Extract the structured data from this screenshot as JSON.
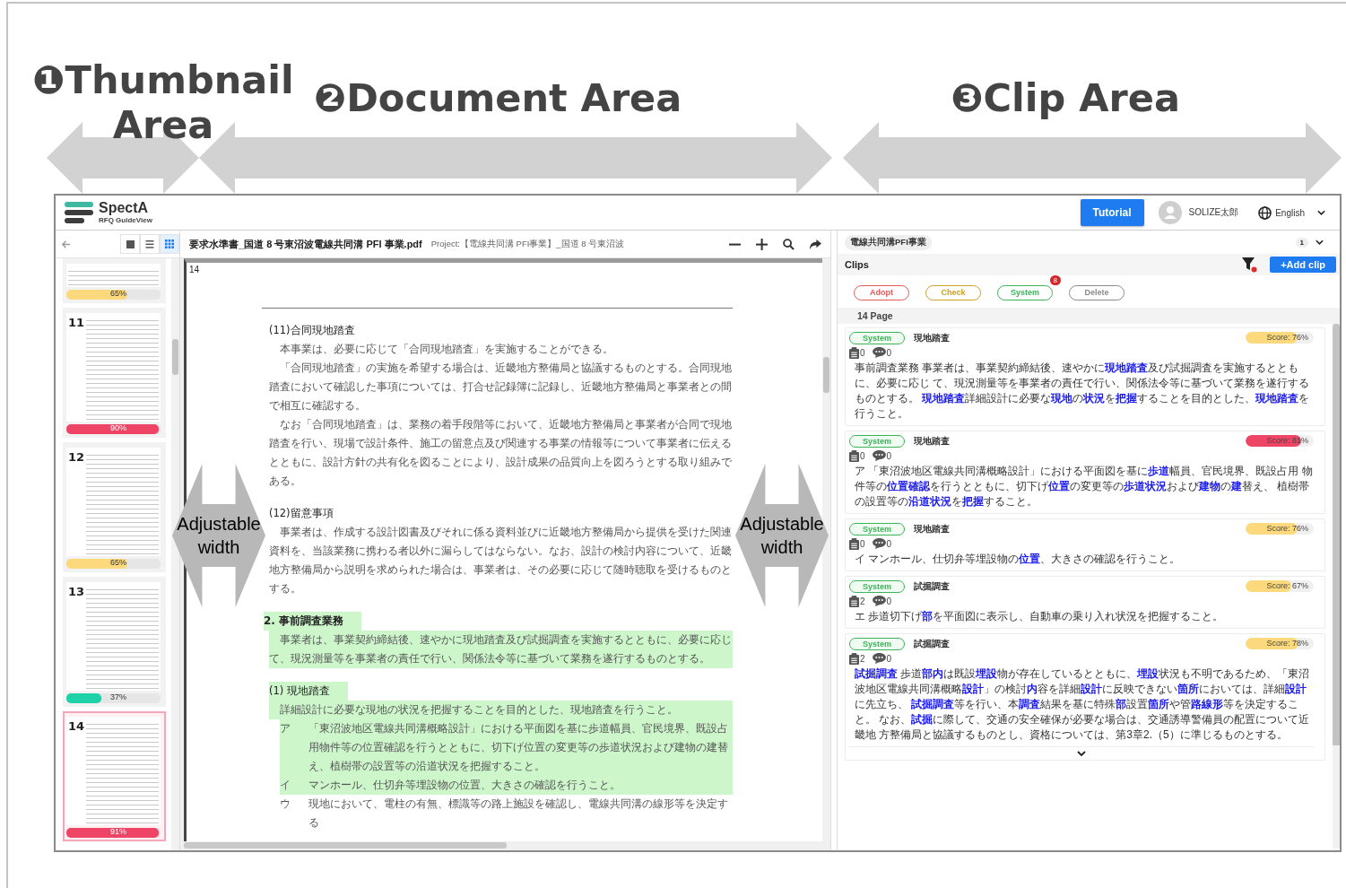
{
  "annotations": {
    "areas": [
      {
        "number": "❶",
        "title": "Thumbnail Area"
      },
      {
        "number": "❷",
        "title": "Document Area"
      },
      {
        "number": "❸",
        "title": "Clip Area"
      }
    ],
    "adjustable": [
      {
        "label": "Adjustable width"
      },
      {
        "label": "Adjustable width"
      }
    ]
  },
  "header": {
    "logo": {
      "name": "SpectA",
      "tagline": "RFQ GuideView"
    },
    "tutorial": "Tutorial",
    "user": "SOLIZE太郎",
    "language": "English"
  },
  "thumbnails": {
    "views": [
      {
        "kind": "single",
        "selected": false
      },
      {
        "kind": "list",
        "selected": false
      },
      {
        "kind": "grid",
        "selected": true
      }
    ],
    "pages": [
      {
        "reading": "65%",
        "level": 0.65,
        "color": "#fcd97c",
        "selected": false
      },
      {
        "page": "11",
        "reading": "90%",
        "level": 0.98,
        "color": "#ee4466",
        "selected": false
      },
      {
        "page": "12",
        "reading": "65%",
        "level": 0.65,
        "color": "#fcd97c",
        "selected": false
      },
      {
        "page": "13",
        "reading": "37%",
        "level": 0.37,
        "color": "#1fd1a8",
        "selected": false
      },
      {
        "page": "14",
        "reading": "91%",
        "level": 0.98,
        "color": "#ee4466",
        "selected": true
      }
    ]
  },
  "document": {
    "filename": "要求水準書_国道 8 号東沼波電線共同溝 PFI 事業.pdf",
    "project": "Project:【電線共同溝 PFI事業】_国道 8 号東沼波",
    "page": "14",
    "blocks": [
      {
        "kind": "subheading",
        "text": "(11)合同現地踏査",
        "highlighted": false
      },
      {
        "kind": "para",
        "text": "本事業は、必要に応じて「合同現地踏査」を実施することができる。",
        "highlighted": false
      },
      {
        "kind": "para",
        "text": "「合同現地踏査」の実施を希望する場合は、近畿地方整備局と協議するものとする。合同現地踏査において確認した事項については、打合せ記録簿に記録し、近畿地方整備局と事業者との間で相互に確認する。",
        "highlighted": false
      },
      {
        "kind": "para",
        "text": "なお「合同現地踏査」は、業務の着手段階等において、近畿地方整備局と事業者が合同で現地踏査を行い、現場で設計条件、施工の留意点及び関連する事業の情報等について事業者に伝えるとともに、設計方針の共有化を図ることにより、設計成果の品質向上を図ろうとする取り組みである。",
        "highlighted": false
      },
      {
        "kind": "subheading",
        "text": "(12)留意事項",
        "highlighted": false
      },
      {
        "kind": "para",
        "text": "事業者は、作成する設計図書及びそれに係る資料並びに近畿地方整備局から提供を受けた関連資料を、当該業務に携わる者以外に漏らしてはならない。なお、設計の検討内容について、近畿地方整備局から説明を求められた場合は、事業者は、その必要に応じて随時聴取を受けるものとする。",
        "highlighted": false
      },
      {
        "kind": "heading",
        "text": "2. 事前調査業務",
        "highlighted": true
      },
      {
        "kind": "para",
        "text": "事業者は、事業契約締結後、速やかに現地踏査及び試掘調査を実施するとともに、必要に応じて、現況測量等を事業者の責任で行い、関係法令等に基づいて業務を遂行するものとする。",
        "highlighted": true
      },
      {
        "kind": "subheading",
        "text": "(1) 現地踏査",
        "highlighted": true
      },
      {
        "kind": "para",
        "text": "詳細設計に必要な現地の状況を把握することを目的とした、現地踏査を行うこと。",
        "highlighted": true
      },
      {
        "kind": "item",
        "mark": "ア",
        "text": "「東沼波地区電線共同溝概略設計」における平面図を基に歩道幅員、官民境界、既設占用物件等の位置確認を行うとともに、切下げ位置の変更等の歩道状況および建物の建替え、植樹帯の設置等の沿道状況を把握すること。",
        "highlighted": true
      },
      {
        "kind": "item",
        "mark": "イ",
        "text": "マンホール、仕切弁等埋設物の位置、大きさの確認を行うこと。",
        "highlighted": true
      },
      {
        "kind": "item",
        "mark": "ウ",
        "text": "現地において、電柱の有無、標識等の路上施設を確認し、電線共同溝の線形等を決定する",
        "highlighted": false
      }
    ]
  },
  "clip_panel": {
    "project_tag": "電線共同溝PFI事業",
    "count": "1",
    "title": "Clips",
    "filter_active": true,
    "add_button": "+Add clip",
    "filters": [
      {
        "label": "Adopt",
        "color": "#e05a5a"
      },
      {
        "label": "Check",
        "color": "#c9a227"
      },
      {
        "label": "System",
        "color": "#3bb35a",
        "badge": "8"
      },
      {
        "label": "Delete",
        "color": "#8a8a8a"
      }
    ],
    "group": "14 Page",
    "clips": [
      {
        "tag": "System",
        "title": "現地踏査",
        "clips": "0",
        "comments": "0",
        "score": "Score: 76%",
        "level": 0.76,
        "color": "#fcd97c",
        "text": "事前調査業務 事業者は、事業契約締結後、速やかに**現地踏査**及び試掘調査を実施するとともに、必要に応じ て、現況測量等を事業者の責任で行い、関係法令等に基づいて業務を遂行するものとする。 **現地踏査**詳細設計に必要な**現地**の**状況**を**把握**することを目的とした、**現地踏査**を行うこと。"
      },
      {
        "tag": "System",
        "title": "現地踏査",
        "clips": "0",
        "comments": "0",
        "score": "Score: 81%",
        "level": 0.81,
        "color": "#ee4466",
        "text": "ア 「東沼波地区電線共同溝概略設計」における平面図を基に**歩道**幅員、官民境界、既設占用 物件等の**位置確認**を行うとともに、切下げ**位置**の変更等の**歩道状況**および**建物**の**建**替え、 植樹帯の設置等の**沿道状況**を**把握**すること。"
      },
      {
        "tag": "System",
        "title": "現地踏査",
        "clips": "0",
        "comments": "0",
        "score": "Score: 76%",
        "level": 0.76,
        "color": "#fcd97c",
        "text": "イ マンホール、仕切弁等埋設物の**位置**、大きさの確認を行うこと。"
      },
      {
        "tag": "System",
        "title": "試掘調査",
        "clips": "2",
        "comments": "0",
        "score": "Score: 67%",
        "level": 0.67,
        "color": "#fcd97c",
        "text": "エ 歩道切下げ**部**を平面図に表示し、自動車の乗り入れ状況を把握すること。"
      },
      {
        "tag": "System",
        "title": "試掘調査",
        "clips": "2",
        "comments": "0",
        "score": "Score: 78%",
        "level": 0.78,
        "color": "#fcd97c",
        "text": "**試掘調査** 歩道**部内**は既設**埋設**物が存在しているとともに、**埋設**状況も不明であるため、「東沼波地区電線共同溝概略**設計**」の検討**内**容を詳細**設計**に反映できない**箇所**においては、詳細**設計**に先立ち、 **試掘調査**等を行い、本**調査**結果を基に特殊**部**設置**箇所**や管**路線形**等を決定すること。 なお、**試掘**に際して、交通の安全確保が必要な場合は、交通誘導警備員の配置について近畿地 方整備局と協議するものとし、資格については、第3章2.（5）に準じるものとする。"
      }
    ]
  }
}
